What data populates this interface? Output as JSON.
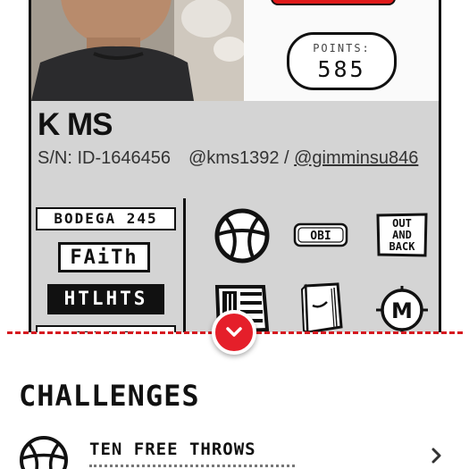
{
  "profile": {
    "points_label": "POINTS:",
    "points_value": "585",
    "name": "K MS",
    "serial": "S/N: ID-1646456",
    "handle": "@kms1392 /",
    "link_handle": "@gimminsu846"
  },
  "patches": {
    "bodega": "BODEGA 245",
    "faith": "FAiTh",
    "htlhts": "HTLHTS",
    "cut": "—— — —— ——"
  },
  "icons": {
    "obi": "OBI",
    "outback": [
      "OUT",
      "AND",
      "BACK"
    ],
    "m": "M"
  },
  "challenges": {
    "title": "CHALLENGES",
    "items": [
      {
        "name": "TEN FREE THROWS"
      }
    ]
  },
  "colors": {
    "accent_red": "#e51f2a",
    "card_gray": "#d4d4d4"
  }
}
